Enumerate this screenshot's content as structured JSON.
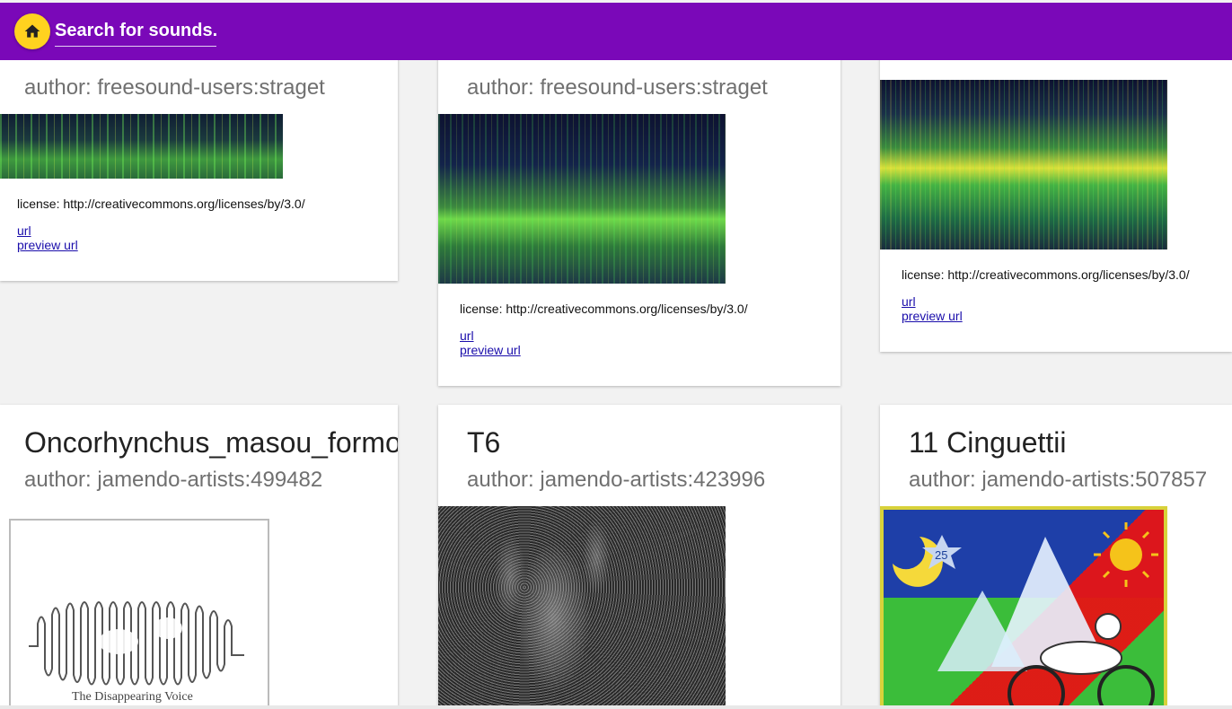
{
  "header": {
    "search_placeholder": "Search for sounds...",
    "home_icon": "home-icon",
    "colors": {
      "bar": "#7a08b8",
      "home_button": "#ffd21f"
    }
  },
  "cards": [
    {
      "title": "",
      "author": "author: freesound-users:straget",
      "license": "license: http://creativecommons.org/licenses/by/3.0/",
      "url_label": "url",
      "preview_url_label": "preview url"
    },
    {
      "title": "",
      "author": "author: freesound-users:straget",
      "license": "license: http://creativecommons.org/licenses/by/3.0/",
      "url_label": "url",
      "preview_url_label": "preview url"
    },
    {
      "title": "",
      "author": "",
      "license": "license: http://creativecommons.org/licenses/by/3.0/",
      "url_label": "url",
      "preview_url_label": "preview url"
    },
    {
      "title": "Oncorhynchus_masou_formosar",
      "author": "author: jamendo-artists:499482",
      "image_caption": "The Disappearing Voice"
    },
    {
      "title": "T6",
      "author": "author: jamendo-artists:423996"
    },
    {
      "title": "11 Cinguettii",
      "author": "author: jamendo-artists:507857",
      "poster_number": "25"
    }
  ]
}
